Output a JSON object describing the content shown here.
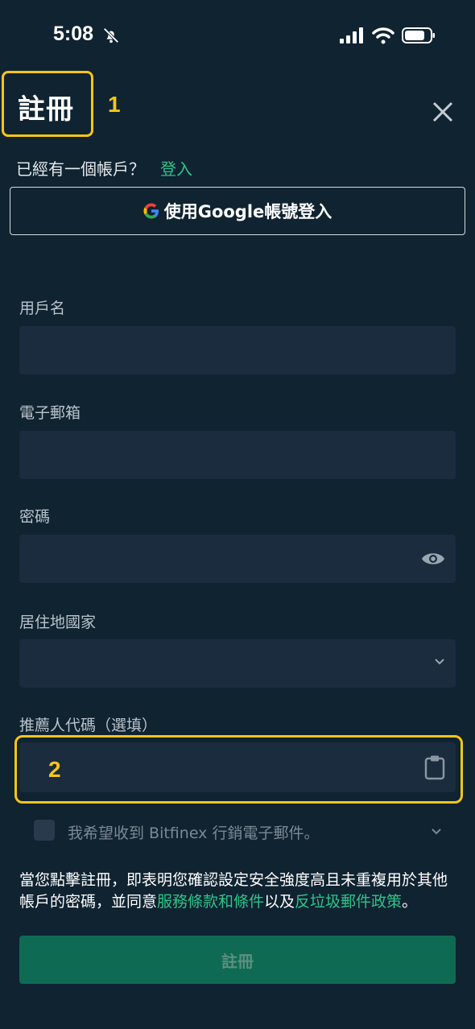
{
  "status_bar": {
    "time": "5:08"
  },
  "header": {
    "title": "註冊",
    "marker_1": "1"
  },
  "login_prompt": {
    "text": "已經有一個帳戶？",
    "link": "登入"
  },
  "google_button": {
    "label": "使用Google帳號登入"
  },
  "fields": {
    "username": {
      "label": "用戶名",
      "value": ""
    },
    "email": {
      "label": "電子郵箱",
      "value": ""
    },
    "password": {
      "label": "密碼",
      "value": ""
    },
    "country": {
      "label": "居住地國家",
      "value": ""
    },
    "referral": {
      "label": "推薦人代碼（選填）",
      "value": "",
      "marker_2": "2"
    }
  },
  "marketing": {
    "text": "我希望收到 Bitfinex 行銷電子郵件。",
    "checked": false
  },
  "terms": {
    "prefix": "當您點擊註冊，即表明您確認設定安全強度高且未重複用於其他帳戶的密碼，並同意",
    "link_terms": "服務條款和條件",
    "middle": "以及",
    "link_antispam": "反垃圾郵件政策",
    "suffix": "。"
  },
  "submit_button": {
    "label": "註冊"
  },
  "colors": {
    "background": "#102331",
    "input_bg": "#1a2c3d",
    "accent_green": "#2bc48a",
    "highlight": "#f5c518",
    "submit_bg": "#0f6a53"
  }
}
